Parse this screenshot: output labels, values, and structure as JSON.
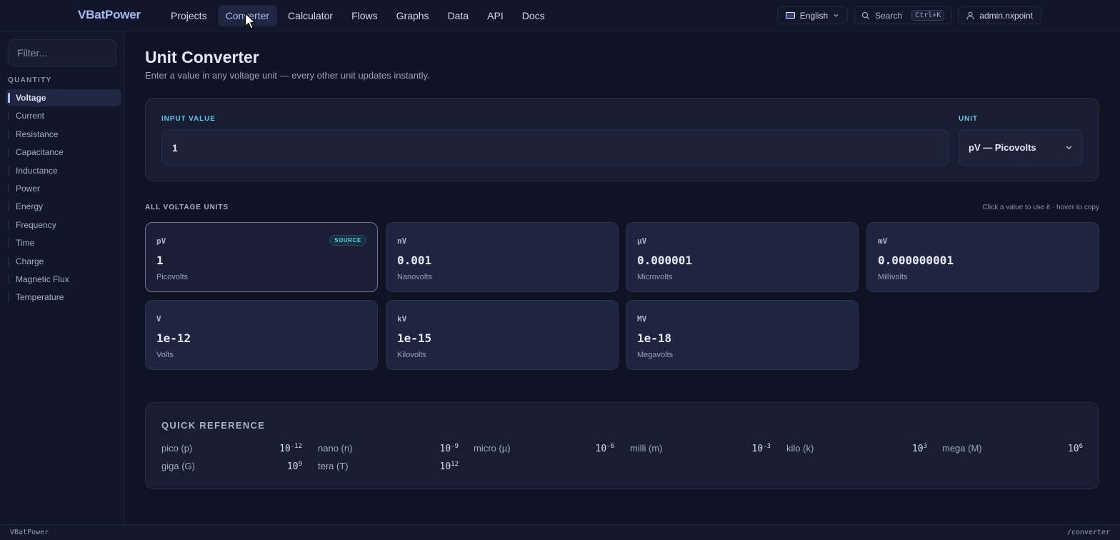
{
  "app": {
    "brand": "VBatPower"
  },
  "nav": {
    "items": [
      {
        "label": "Projects",
        "active": false
      },
      {
        "label": "Converter",
        "active": true
      },
      {
        "label": "Calculator",
        "active": false
      },
      {
        "label": "Flows",
        "active": false
      },
      {
        "label": "Graphs",
        "active": false
      },
      {
        "label": "Data",
        "active": false
      },
      {
        "label": "API",
        "active": false
      },
      {
        "label": "Docs",
        "active": false
      }
    ],
    "language": "English",
    "search_label": "Search",
    "search_shortcut": "Ctrl+K",
    "user": "admin.nxpoint"
  },
  "sidebar": {
    "filter_placeholder": "Filter...",
    "section_title": "QUANTITY",
    "items": [
      {
        "label": "Voltage",
        "active": true
      },
      {
        "label": "Current",
        "active": false
      },
      {
        "label": "Resistance",
        "active": false
      },
      {
        "label": "Capacitance",
        "active": false
      },
      {
        "label": "Inductance",
        "active": false
      },
      {
        "label": "Power",
        "active": false
      },
      {
        "label": "Energy",
        "active": false
      },
      {
        "label": "Frequency",
        "active": false
      },
      {
        "label": "Time",
        "active": false
      },
      {
        "label": "Charge",
        "active": false
      },
      {
        "label": "Magnetic Flux",
        "active": false
      },
      {
        "label": "Temperature",
        "active": false
      }
    ]
  },
  "main": {
    "title": "Unit Converter",
    "subtitle": "Enter a value in any voltage unit — every other unit updates instantly.",
    "input": {
      "label": "INPUT VALUE",
      "value": "1",
      "unit_label": "UNIT",
      "unit_value": "pV — Picovolts"
    },
    "units_section": {
      "title": "ALL VOLTAGE UNITS",
      "hint": "Click a value to use it · hover to copy",
      "source_badge": "SOURCE",
      "cards": [
        {
          "symbol": "pV",
          "value": "1",
          "name": "Picovolts",
          "source": true
        },
        {
          "symbol": "nV",
          "value": "0.001",
          "name": "Nanovolts",
          "source": false
        },
        {
          "symbol": "µV",
          "value": "0.000001",
          "name": "Microvolts",
          "source": false
        },
        {
          "symbol": "mV",
          "value": "0.000000001",
          "name": "Millivolts",
          "source": false
        },
        {
          "symbol": "V",
          "value": "1e-12",
          "name": "Volts",
          "source": false
        },
        {
          "symbol": "kV",
          "value": "1e-15",
          "name": "Kilovolts",
          "source": false
        },
        {
          "symbol": "MV",
          "value": "1e-18",
          "name": "Megavolts",
          "source": false
        }
      ]
    },
    "quick_reference": {
      "title": "QUICK REFERENCE",
      "items": [
        {
          "name": "pico (p)",
          "base": "10",
          "exp": "-12"
        },
        {
          "name": "nano (n)",
          "base": "10",
          "exp": "-9"
        },
        {
          "name": "micro (µ)",
          "base": "10",
          "exp": "-6"
        },
        {
          "name": "milli (m)",
          "base": "10",
          "exp": "-3"
        },
        {
          "name": "kilo (k)",
          "base": "10",
          "exp": "3"
        },
        {
          "name": "mega (M)",
          "base": "10",
          "exp": "6"
        },
        {
          "name": "giga (G)",
          "base": "10",
          "exp": "9"
        },
        {
          "name": "tera (T)",
          "base": "10",
          "exp": "12"
        }
      ]
    }
  },
  "status_bar": {
    "left": "VBatPower",
    "right": "/converter"
  },
  "colors": {
    "accent": "#a9bbf3",
    "cyan": "#5ec9e8",
    "background": "#0f1324"
  }
}
